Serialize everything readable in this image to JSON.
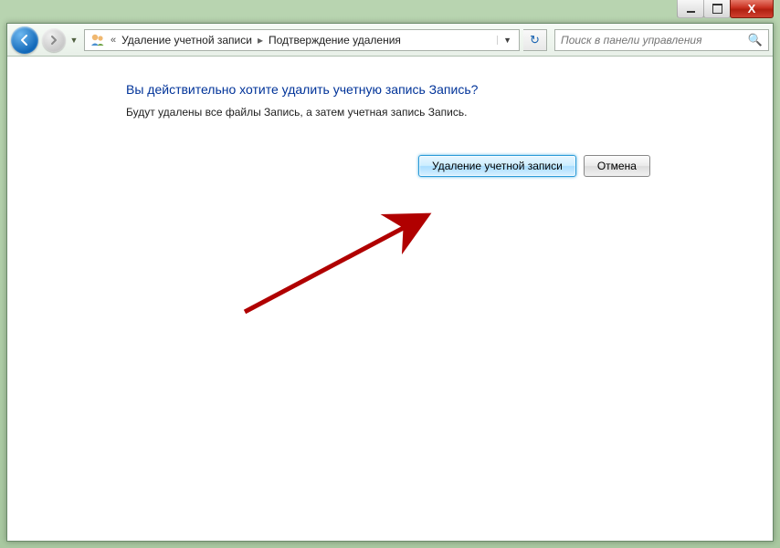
{
  "breadcrumb": {
    "seg1": "Удаление учетной записи",
    "seg2": "Подтверждение удаления"
  },
  "search": {
    "placeholder": "Поиск в панели управления"
  },
  "content": {
    "heading": "Вы действительно хотите удалить учетную запись Запись?",
    "body": "Будут удалены все файлы Запись, а затем учетная запись Запись."
  },
  "buttons": {
    "delete": "Удаление учетной записи",
    "cancel": "Отмена"
  },
  "window_controls": {
    "close_glyph": "X"
  }
}
